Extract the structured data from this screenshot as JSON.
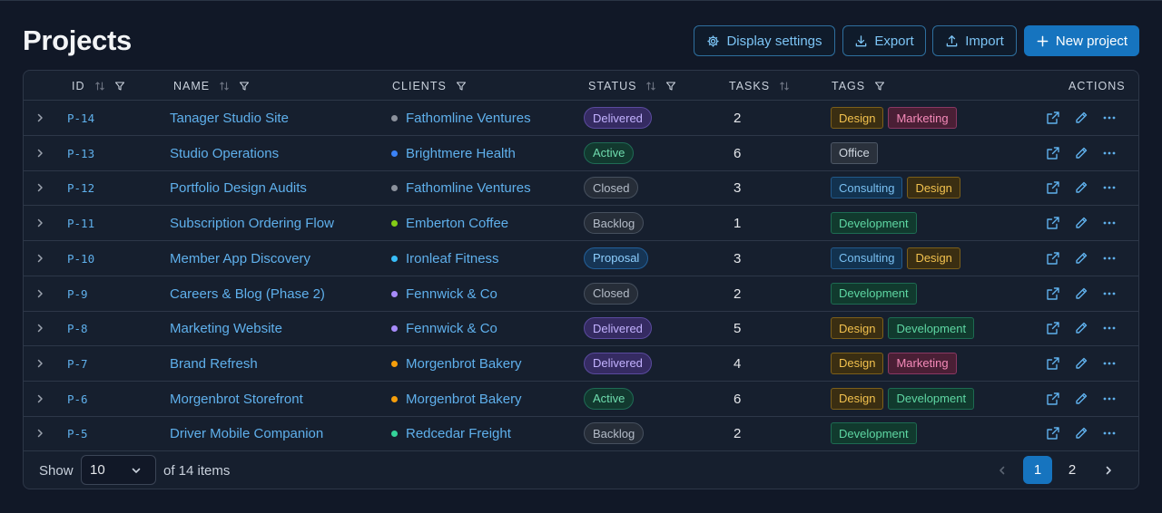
{
  "page": {
    "title": "Projects"
  },
  "toolbar": {
    "display_settings": "Display settings",
    "export": "Export",
    "import": "Import",
    "new_project": "New project"
  },
  "table": {
    "columns": {
      "id": "ID",
      "name": "NAME",
      "clients": "CLIENTS",
      "status": "STATUS",
      "tasks": "TASKS",
      "tags": "TAGS",
      "actions": "ACTIONS"
    },
    "rows": [
      {
        "id": "P-14",
        "name": "Tanager Studio Site",
        "client": "Fathomline Ventures",
        "client_color": "#8b919c",
        "status": "Delivered",
        "status_kind": "delivered",
        "tasks": "2",
        "tags": [
          {
            "label": "Design",
            "kind": "design"
          },
          {
            "label": "Marketing",
            "kind": "marketing"
          }
        ]
      },
      {
        "id": "P-13",
        "name": "Studio Operations",
        "client": "Brightmere Health",
        "client_color": "#3b82f6",
        "status": "Active",
        "status_kind": "active",
        "tasks": "6",
        "tags": [
          {
            "label": "Office",
            "kind": "office"
          }
        ]
      },
      {
        "id": "P-12",
        "name": "Portfolio Design Audits",
        "client": "Fathomline Ventures",
        "client_color": "#8b919c",
        "status": "Closed",
        "status_kind": "closed",
        "tasks": "3",
        "tags": [
          {
            "label": "Consulting",
            "kind": "consulting"
          },
          {
            "label": "Design",
            "kind": "design"
          }
        ]
      },
      {
        "id": "P-11",
        "name": "Subscription Ordering Flow",
        "client": "Emberton Coffee",
        "client_color": "#84cc16",
        "status": "Backlog",
        "status_kind": "backlog",
        "tasks": "1",
        "tags": [
          {
            "label": "Development",
            "kind": "development"
          }
        ]
      },
      {
        "id": "P-10",
        "name": "Member App Discovery",
        "client": "Ironleaf Fitness",
        "client_color": "#38bdf8",
        "status": "Proposal",
        "status_kind": "proposal",
        "tasks": "3",
        "tags": [
          {
            "label": "Consulting",
            "kind": "consulting"
          },
          {
            "label": "Design",
            "kind": "design"
          }
        ]
      },
      {
        "id": "P-9",
        "name": "Careers & Blog (Phase 2)",
        "client": "Fennwick & Co",
        "client_color": "#a78bfa",
        "status": "Closed",
        "status_kind": "closed",
        "tasks": "2",
        "tags": [
          {
            "label": "Development",
            "kind": "development"
          }
        ]
      },
      {
        "id": "P-8",
        "name": "Marketing Website",
        "client": "Fennwick & Co",
        "client_color": "#a78bfa",
        "status": "Delivered",
        "status_kind": "delivered",
        "tasks": "5",
        "tags": [
          {
            "label": "Design",
            "kind": "design"
          },
          {
            "label": "Development",
            "kind": "development"
          }
        ]
      },
      {
        "id": "P-7",
        "name": "Brand Refresh",
        "client": "Morgenbrot Bakery",
        "client_color": "#f59e0b",
        "status": "Delivered",
        "status_kind": "delivered",
        "tasks": "4",
        "tags": [
          {
            "label": "Design",
            "kind": "design"
          },
          {
            "label": "Marketing",
            "kind": "marketing"
          }
        ]
      },
      {
        "id": "P-6",
        "name": "Morgenbrot Storefront",
        "client": "Morgenbrot Bakery",
        "client_color": "#f59e0b",
        "status": "Active",
        "status_kind": "active",
        "tasks": "6",
        "tags": [
          {
            "label": "Design",
            "kind": "design"
          },
          {
            "label": "Development",
            "kind": "development"
          }
        ]
      },
      {
        "id": "P-5",
        "name": "Driver Mobile Companion",
        "client": "Redcedar Freight",
        "client_color": "#34d399",
        "status": "Backlog",
        "status_kind": "backlog",
        "tasks": "2",
        "tags": [
          {
            "label": "Development",
            "kind": "development"
          }
        ]
      }
    ]
  },
  "footer": {
    "show_label": "Show",
    "page_size": "10",
    "of_items": "of 14 items",
    "pages": [
      "1",
      "2"
    ],
    "current_page": "1"
  },
  "colors": {
    "background": "#111827",
    "accent": "#1674bf",
    "link": "#5fb0ec"
  }
}
